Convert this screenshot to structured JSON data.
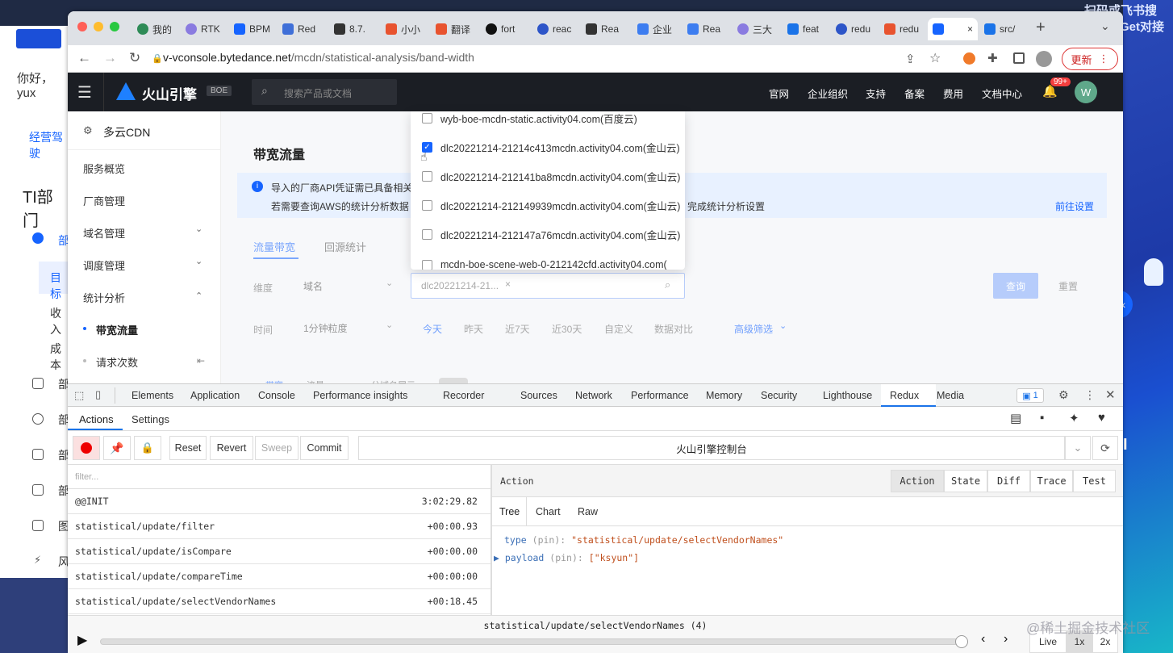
{
  "bg": {
    "greeting": "你好，yux",
    "link": "经营驾驶",
    "section": "TI部门",
    "nav": [
      "部",
      "目标",
      "收入",
      "成本",
      "部",
      "部",
      "部",
      "部",
      "图",
      "风"
    ],
    "right_text": [
      "扫码或飞书搜",
      "Get对接"
    ],
    "watermark": "@稀土掘金技术社区"
  },
  "browser": {
    "tabs": [
      "我的",
      "RTK",
      "BPM",
      "Red",
      "8.7.",
      "小小",
      "翻译",
      "fort",
      "reac",
      "Rea",
      "企业",
      "Rea",
      "三大",
      "feat",
      "redu",
      "redu",
      "",
      "src/"
    ],
    "url_host": "v-vconsole.bytedance.net",
    "url_path": "/mcdn/statistical-analysis/band-width",
    "update_label": "更新"
  },
  "app": {
    "brand": "火山引擎",
    "env": "BOE",
    "search_placeholder": "搜索产品或文档",
    "top_nav": [
      "官网",
      "企业组织",
      "支持",
      "备案",
      "费用",
      "文档中心"
    ],
    "badge": "99+",
    "avatar": "W",
    "sidebar_title": "多云CDN",
    "sidebar": [
      "服务概览",
      "厂商管理",
      "域名管理",
      "调度管理",
      "统计分析",
      "带宽流量",
      "请求次数"
    ],
    "page_title": "带宽流量",
    "notice1": "导入的厂商API凭证需已具备相关",
    "notice2": "若需要查询AWS的统计分析数据",
    "notice2b": "完成统计分析设置",
    "notice_link": "前往设置",
    "tabs": [
      "流量带宽",
      "回源统计"
    ],
    "dim_label": "维度",
    "dim_value": "域名",
    "domain_value": "dlc20221214-21...",
    "query": "查询",
    "reset": "重置",
    "time_label": "时间",
    "granularity": "1分钟粒度",
    "time_opts": [
      "今天",
      "昨天",
      "近7天",
      "近30天",
      "自定义",
      "数据对比"
    ],
    "advanced": "高级筛选",
    "chart_tabs": [
      "带宽",
      "流量",
      "分域名展示"
    ],
    "dropdown": [
      {
        "label": "wyb-boe-mcdn-static.activity04.com(百度云)",
        "checked": false
      },
      {
        "label": "dlc20221214-21214c413mcdn.activity04.com(金山云)",
        "checked": true
      },
      {
        "label": "dlc20221214-212141ba8mcdn.activity04.com(金山云)",
        "checked": false
      },
      {
        "label": "dlc20221214-212149939mcdn.activity04.com(金山云)",
        "checked": false
      },
      {
        "label": "dlc20221214-212147a76mcdn.activity04.com(金山云)",
        "checked": false
      },
      {
        "label": "mcdn-boe-scene-web-0-212142cfd.activity04.com(",
        "checked": false
      }
    ]
  },
  "devtools": {
    "tabs": [
      "Elements",
      "Application",
      "Console",
      "Performance insights",
      "Recorder",
      "Sources",
      "Network",
      "Performance",
      "Memory",
      "Security",
      "Lighthouse",
      "Redux",
      "Media"
    ],
    "issues": "1",
    "redux": {
      "subtabs": [
        "Actions",
        "Settings"
      ],
      "buttons": [
        "Reset",
        "Revert",
        "Sweep",
        "Commit"
      ],
      "instance": "火山引擎控制台",
      "filter_placeholder": "filter...",
      "actions": [
        {
          "name": "@@INIT",
          "time": "3:02:29.82"
        },
        {
          "name": "statistical/update/filter",
          "time": "+00:00.93"
        },
        {
          "name": "statistical/update/isCompare",
          "time": "+00:00.00"
        },
        {
          "name": "statistical/update/compareTime",
          "time": "+00:00:00"
        },
        {
          "name": "statistical/update/selectVendorNames",
          "time": "+00:18.45"
        }
      ],
      "detail_title": "Action",
      "detail_tabs": [
        "Action",
        "State",
        "Diff",
        "Trace",
        "Test"
      ],
      "view_tabs": [
        "Tree",
        "Chart",
        "Raw"
      ],
      "tree": {
        "type_key": "type",
        "type_pin": "(pin):",
        "type_val": "\"statistical/update/selectVendorNames\"",
        "payload_key": "payload",
        "payload_pin": "(pin):",
        "payload_val": "[\"ksyun\"]"
      },
      "footer": "statistical/update/selectVendorNames (4)",
      "speed": [
        "Live",
        "1x",
        "2x"
      ]
    }
  }
}
